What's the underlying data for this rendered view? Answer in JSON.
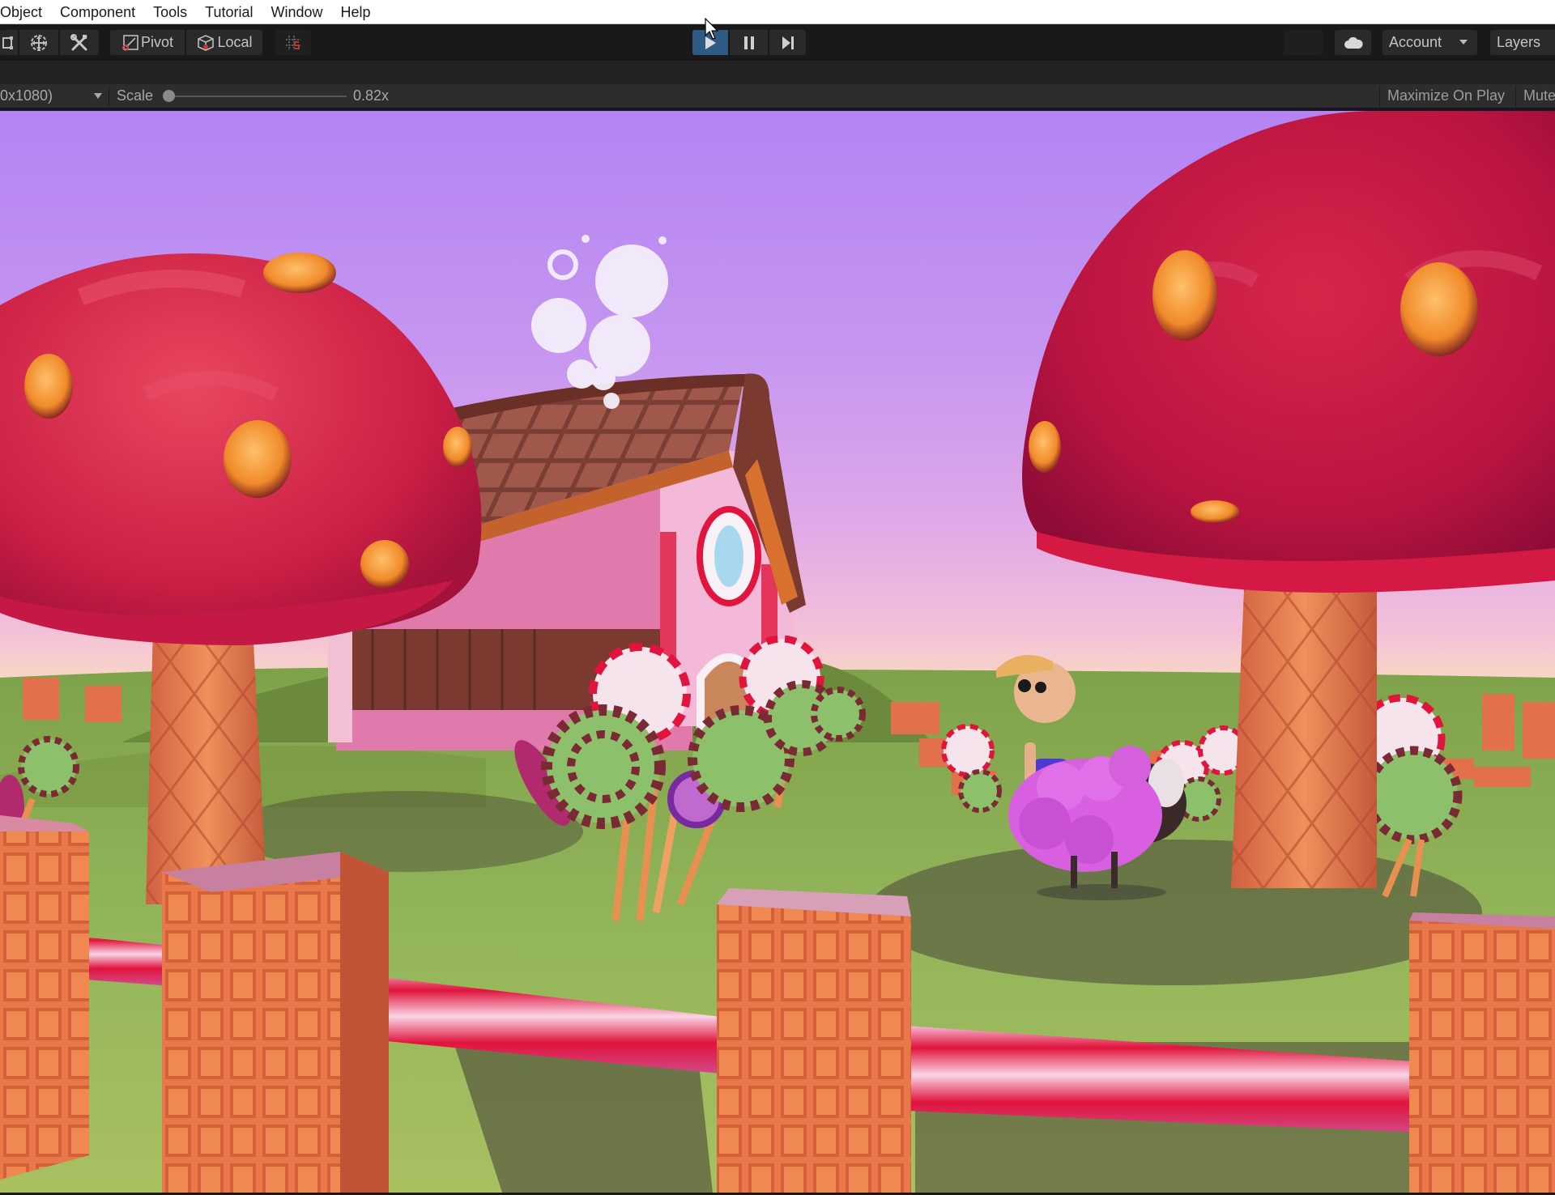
{
  "menubar": {
    "items": [
      "Object",
      "Component",
      "Tools",
      "Tutorial",
      "Window",
      "Help"
    ]
  },
  "toolbar": {
    "transform_tools": [
      {
        "name": "rect-tool",
        "icon": "rect-transform-icon"
      },
      {
        "name": "transform-tool",
        "icon": "move-rotate-scale-icon"
      },
      {
        "name": "custom-tool",
        "icon": "tools-icon"
      }
    ],
    "pivot_label": "Pivot",
    "local_label": "Local",
    "grid_snap_icon": "grid-snap-icon",
    "play_controls": {
      "play": {
        "icon": "play-icon",
        "active": true
      },
      "pause": {
        "icon": "pause-icon",
        "active": false
      },
      "step": {
        "icon": "step-icon",
        "active": false
      }
    },
    "cloud_icon": "cloud-icon",
    "account_label": "Account",
    "layers_label": "Layers"
  },
  "game_toolbar": {
    "resolution_label": "0x1080)",
    "scale_label": "Scale",
    "scale_value": "0.82x",
    "scale_slider_fraction": 0.0,
    "maximize_on_play_label": "Maximize On Play",
    "mute_label": "Mute"
  },
  "colors": {
    "play_active": "#2e5a84",
    "toolbar_bg": "#191919",
    "game_toolbar_bg": "#2d2d2d",
    "sky_top": "#b384f2",
    "sky_horizon": "#fbe7b8",
    "grass": "#8fae55",
    "mushroom_cap": "#d0234a",
    "mushroom_spot": "#f39a2e",
    "waffle": "#e9784a",
    "candy_stripe": "#e01d45"
  },
  "scene": {
    "description": "Candy-land game view: giant red mushrooms, chocolate-roof candy house, swirl lollipops, pink sheep, farmer character, waffle fence with candy-cane rails"
  }
}
